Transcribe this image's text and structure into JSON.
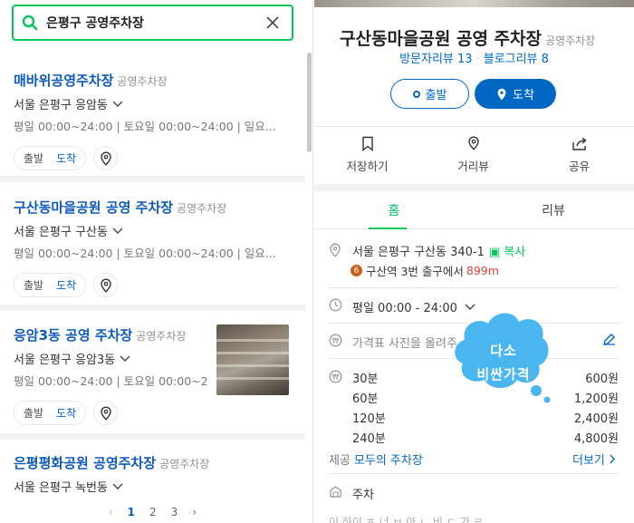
{
  "search": {
    "query": "은평구 공영주차장"
  },
  "results": [
    {
      "name": "매바위공영주차장",
      "category": "공영주차장",
      "address": "서울 은평구 응암동",
      "hours": "평일 00:00~24:00 | 토요일 00:00~24:00 | 일요...",
      "depart": "출발",
      "arrive": "도착"
    },
    {
      "name": "구산동마을공원 공영 주차장",
      "category": "공영주차장",
      "address": "서울 은평구 구산동",
      "hours": "평일 00:00~24:00 | 토요일 00:00~24:00 | 일요...",
      "depart": "출발",
      "arrive": "도착"
    },
    {
      "name": "응암3동 공영 주차장",
      "category": "공영주차장",
      "address": "서울 은평구 응암3동",
      "hours": "평일 00:00~24:00 | 토요일 00:00~24:",
      "depart": "출발",
      "arrive": "도착"
    },
    {
      "name": "은평평화공원 공영주차장",
      "category": "공영주차장",
      "address": "서울 은평구 녹번동"
    }
  ],
  "pagination": {
    "pages": [
      "1",
      "2",
      "3"
    ],
    "current": "1",
    "prev": "‹",
    "next": "›"
  },
  "detail": {
    "name": "구산동마을공원 공영 주차장",
    "category": "공영주차장",
    "visitor_reviews": "방문자리뷰 13",
    "blog_reviews": "블로그리뷰 8",
    "depart_button": "출발",
    "arrive_button": "도착",
    "actions": {
      "save": "저장하기",
      "street_view": "거리뷰",
      "share": "공유"
    },
    "tabs": {
      "home": "홈",
      "review": "리뷰"
    },
    "address": "서울 은평구 구산동 340-1",
    "copy": "복사",
    "subway_line": "6",
    "subway": "구산역 3번 출구에서",
    "subway_distance": "899m",
    "hours": "평일 00:00 - 24:00",
    "price_hint": "가격표 사진을 올려주",
    "prices": [
      {
        "duration": "30분",
        "price": "600원"
      },
      {
        "duration": "60분",
        "price": "1,200원"
      },
      {
        "duration": "120분",
        "price": "2,400원"
      },
      {
        "duration": "240분",
        "price": "4,800원"
      }
    ],
    "provider_label": "제공",
    "provider": "모두의 주차장",
    "more": "더보기",
    "parking": "주차",
    "faint_row": "이 하이 ㅎ 너 ㅂ 아 ㄴ 비 ㄷ 가 ㄹ"
  },
  "note": {
    "line1": "다소",
    "line2": "비싼가격",
    "color": "#49b6ef"
  },
  "colors": {
    "brand_green": "#03c75a",
    "link_blue": "#0068c3",
    "title_blue": "#0d5ab9",
    "distance_red": "#e0423b"
  }
}
